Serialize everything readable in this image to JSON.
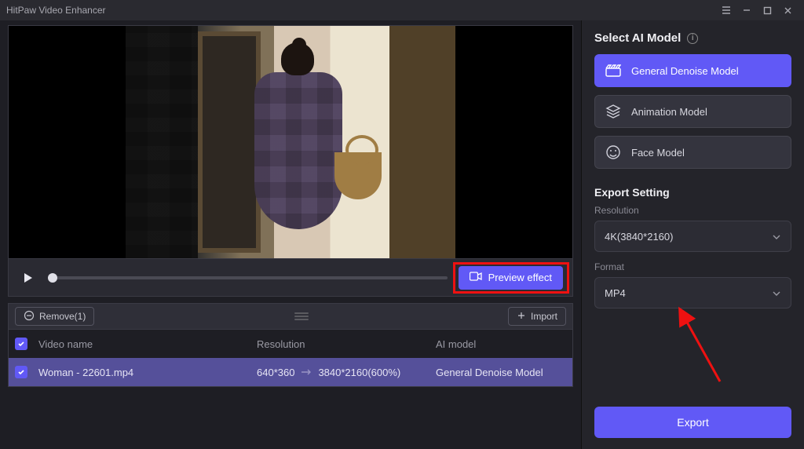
{
  "app": {
    "title": "HitPaw Video Enhancer"
  },
  "preview": {
    "button_label": "Preview effect"
  },
  "list_toolbar": {
    "remove_label": "Remove(1)",
    "import_label": "Import"
  },
  "table": {
    "headers": {
      "name": "Video name",
      "resolution": "Resolution",
      "model": "AI model"
    },
    "rows": [
      {
        "name": "Woman - 22601.mp4",
        "res_from": "640*360",
        "res_to": "3840*2160(600%)",
        "model": "General Denoise Model"
      }
    ]
  },
  "sidebar": {
    "section_model": "Select AI Model",
    "models": [
      {
        "label": "General Denoise Model",
        "active": true
      },
      {
        "label": "Animation Model",
        "active": false
      },
      {
        "label": "Face Model",
        "active": false
      }
    ],
    "section_export": "Export Setting",
    "resolution_label": "Resolution",
    "resolution_value": "4K(3840*2160)",
    "format_label": "Format",
    "format_value": "MP4",
    "export_button": "Export"
  }
}
